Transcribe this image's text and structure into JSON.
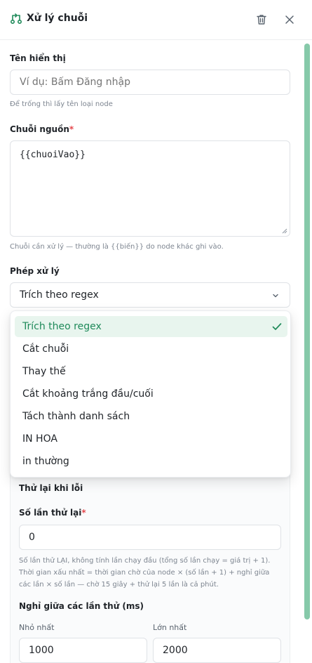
{
  "header": {
    "title": "Xử lý chuỗi"
  },
  "display_name": {
    "label": "Tên hiển thị",
    "placeholder": "Ví dụ: Bấm Đăng nhập",
    "hint": "Để trống thì lấy tên loại node"
  },
  "source_string": {
    "label": "Chuỗi nguồn",
    "required_mark": "*",
    "value": "{{chuoiVao}}",
    "hint": "Chuỗi cần xử lý — thường là {{biến}} do node khác ghi vào."
  },
  "operation": {
    "label": "Phép xử lý",
    "selected": "Trích theo regex",
    "options": [
      "Trích theo regex",
      "Cắt chuỗi",
      "Thay thế",
      "Cắt khoảng trắng đầu/cuối",
      "Tách thành danh sách",
      "IN HOA",
      "in thường"
    ]
  },
  "retry": {
    "section_title": "Thử lại khi lỗi",
    "count_label": "Số lần thử lại",
    "required_mark": "*",
    "count_value": "0",
    "hint_lines": [
      "Số lần thử LẠI, không tính lần chạy đầu (tổng số lần chạy = giá trị + 1).",
      "Thời gian xấu nhất = thời gian chờ của node × (số lần + 1) + nghỉ giữa",
      "các lần × số lần — chờ 15 giây + thử lại 5 lần là cả phút."
    ],
    "delay_label": "Nghỉ giữa các lần thử (ms)",
    "min_label": "Nhỏ nhất",
    "min_value": "1000",
    "max_label": "Lớn nhất",
    "max_value": "2000"
  },
  "colors": {
    "accent": "#1f8a5a",
    "selected_bg": "#e8f5ee",
    "scroll_thumb": "#86c9a9",
    "required": "#e5484d"
  }
}
